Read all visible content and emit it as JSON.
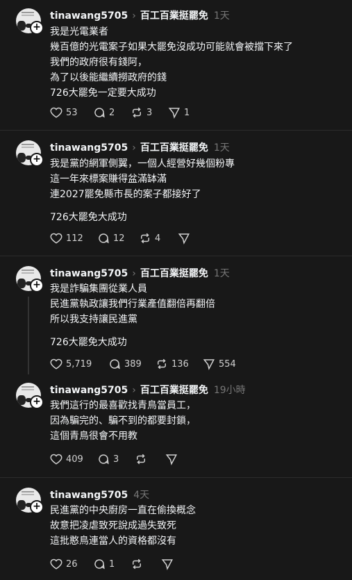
{
  "posts": [
    {
      "username": "tinawang5705",
      "topic": "百工百業挺罷免",
      "time": "1天",
      "lines": [
        "我是光電業者",
        "幾百億的光電案子如果大罷免沒成功可能就會被擋下來了",
        "我們的政府很有錢阿，",
        "為了以後能繼續撈政府的錢",
        "726大罷免一定要大成功"
      ],
      "likes": "53",
      "replies": "2",
      "reposts": "3",
      "shares": "1"
    },
    {
      "username": "tinawang5705",
      "topic": "百工百業挺罷免",
      "time": "1天",
      "lines": [
        "我是黨的網軍側翼，一個人經營好幾個粉專",
        "這一年來標案賺得盆滿缽滿",
        "連2027罷免縣市長的案子都接好了"
      ],
      "extra": "726大罷免大成功",
      "likes": "112",
      "replies": "12",
      "reposts": "4",
      "shares": ""
    },
    {
      "username": "tinawang5705",
      "topic": "百工百業挺罷免",
      "time": "1天",
      "lines": [
        "我是詐騙集團從業人員",
        "民進黨執政讓我們行業產值翻倍再翻倍",
        "所以我支持讓民進黨"
      ],
      "extra": "726大罷免大成功",
      "likes": "5,719",
      "replies": "389",
      "reposts": "136",
      "shares": "554"
    },
    {
      "username": "tinawang5705",
      "topic": "百工百業挺罷免",
      "time": "19小時",
      "lines": [
        "我們這行的最喜歡找青鳥當員工，",
        "因為騙完的、騙不到的都要封鎖，",
        "這個青鳥很會不用教"
      ],
      "likes": "409",
      "replies": "3",
      "reposts": "",
      "shares": ""
    },
    {
      "username": "tinawang5705",
      "topic": "",
      "time": "4天",
      "lines": [
        "民進黨的中央廚房一直在偷換概念",
        "故意把凌虐致死說成過失致死",
        "這批憨鳥連當人的資格都沒有"
      ],
      "likes": "26",
      "replies": "1",
      "reposts": "",
      "shares": ""
    }
  ]
}
